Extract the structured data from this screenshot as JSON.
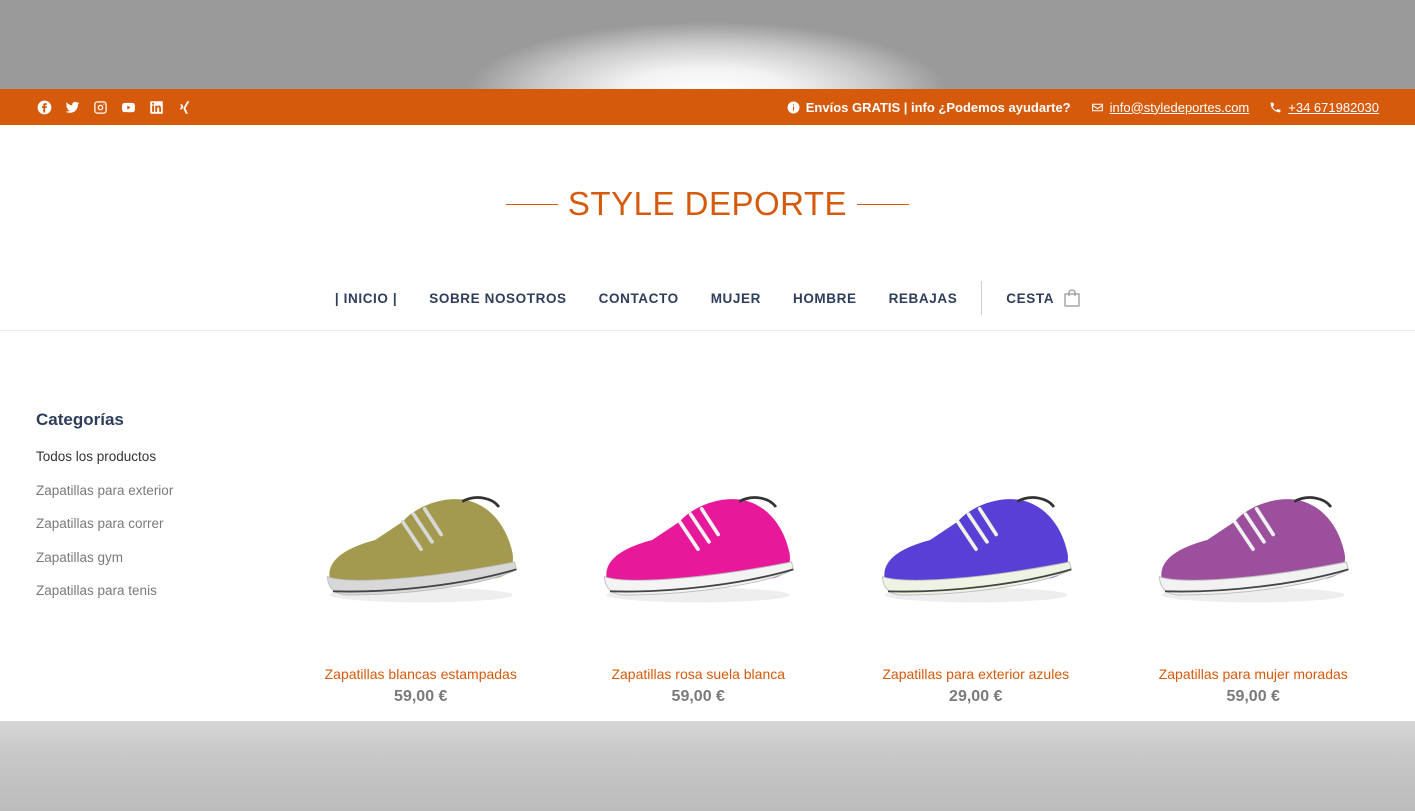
{
  "topbar": {
    "social": [
      "facebook-icon",
      "twitter-icon",
      "instagram-icon",
      "youtube-icon",
      "linkedin-icon",
      "xing-icon"
    ],
    "shipping_text": "Envíos GRATIS | info ¿Podemos ayudarte?",
    "email": "info@styledeportes.com",
    "phone": "+34 671982030"
  },
  "logo": {
    "text": "STYLE DEPORTE"
  },
  "nav": {
    "items": [
      "| INICIO |",
      "SOBRE NOSOTROS",
      "CONTACTO",
      "MUJER",
      "HOMBRE",
      "REBAJAS"
    ],
    "cart": "CESTA"
  },
  "sidebar": {
    "title": "Categorías",
    "items": [
      "Todos los productos",
      "Zapatillas para exterior",
      "Zapatillas para correr",
      "Zapatillas gym",
      "Zapatillas para tenis"
    ]
  },
  "products": [
    {
      "name": "Zapatillas blancas estampadas",
      "price": "59,00 €",
      "color": "#a39a4f",
      "accent": "#d8d8d8"
    },
    {
      "name": "Zapatillas rosa suela blanca",
      "price": "59,00 €",
      "color": "#e8189a",
      "accent": "#f4f4f4"
    },
    {
      "name": "Zapatillas para exterior azules",
      "price": "29,00 €",
      "color": "#5a3fd6",
      "accent": "#eef4e4"
    },
    {
      "name": "Zapatillas para mujer moradas",
      "price": "59,00 €",
      "color": "#9c4f9c",
      "accent": "#f2f2f2"
    }
  ],
  "colors": {
    "brand": "#d65a0b",
    "nav_text": "#2f3d5c"
  }
}
